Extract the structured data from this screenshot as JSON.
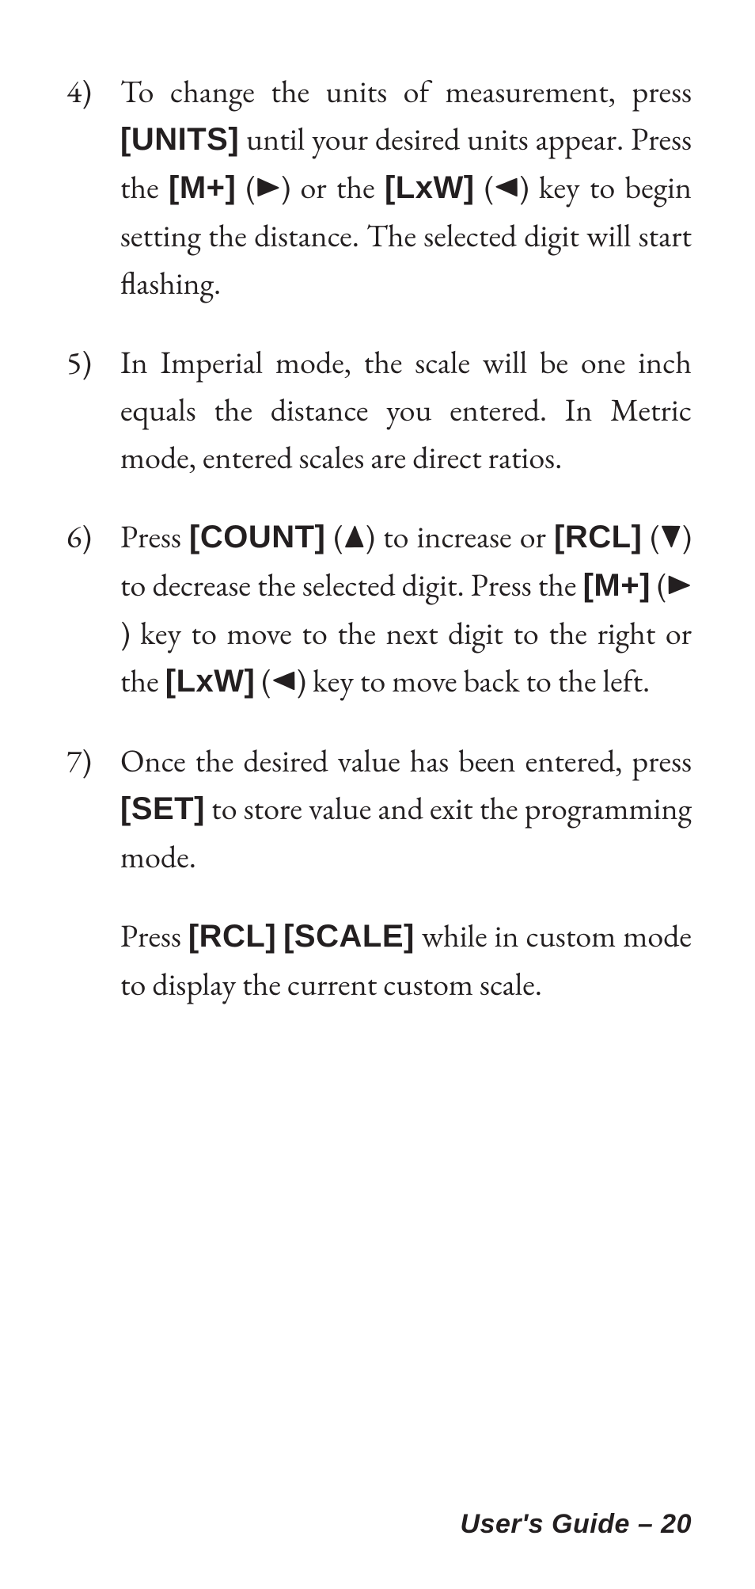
{
  "footer": "User's Guide – 20",
  "arrows": {
    "right": "▶",
    "left": "◀",
    "up": "▲",
    "down": "▼"
  },
  "btn": {
    "units": "[UNITS]",
    "mplus": "[M+]",
    "lxw": "[LxW]",
    "count": "[COUNT]",
    "rcl": "[RCL]",
    "set": "[SET]",
    "scale": "[SCALE]"
  },
  "items": [
    {
      "num": "4)",
      "t0": "To change the units of  measurement, press ",
      "t1": " until your desired units appear. Press the ",
      "t2": " (",
      "t3": ") or the ",
      "t4": " (",
      "t5": ") key to begin setting the distance. The selected digit will start flashing."
    },
    {
      "num": "5)",
      "t0": "In Imperial mode, the scale will be one inch equals the distance you entered. In Metric mode, entered scales are direct ratios."
    },
    {
      "num": "6)",
      "t0": "Press ",
      "t1": " (",
      "t2": ") to increase or ",
      "t3": " (",
      "t4": ") to decrease the selected digit. Press the ",
      "t5": " (",
      "t6": ") key to move to the next digit to the right or the ",
      "t7": " (",
      "t8": ") key to move back to the left."
    },
    {
      "num": "7)",
      "p1a": "Once the desired value has been entered, press ",
      "p1b": " to store value and exit the programming mode.",
      "p2a": "Press ",
      "p2b": " ",
      "p2c": " while in custom mode to display the current custom scale."
    }
  ]
}
